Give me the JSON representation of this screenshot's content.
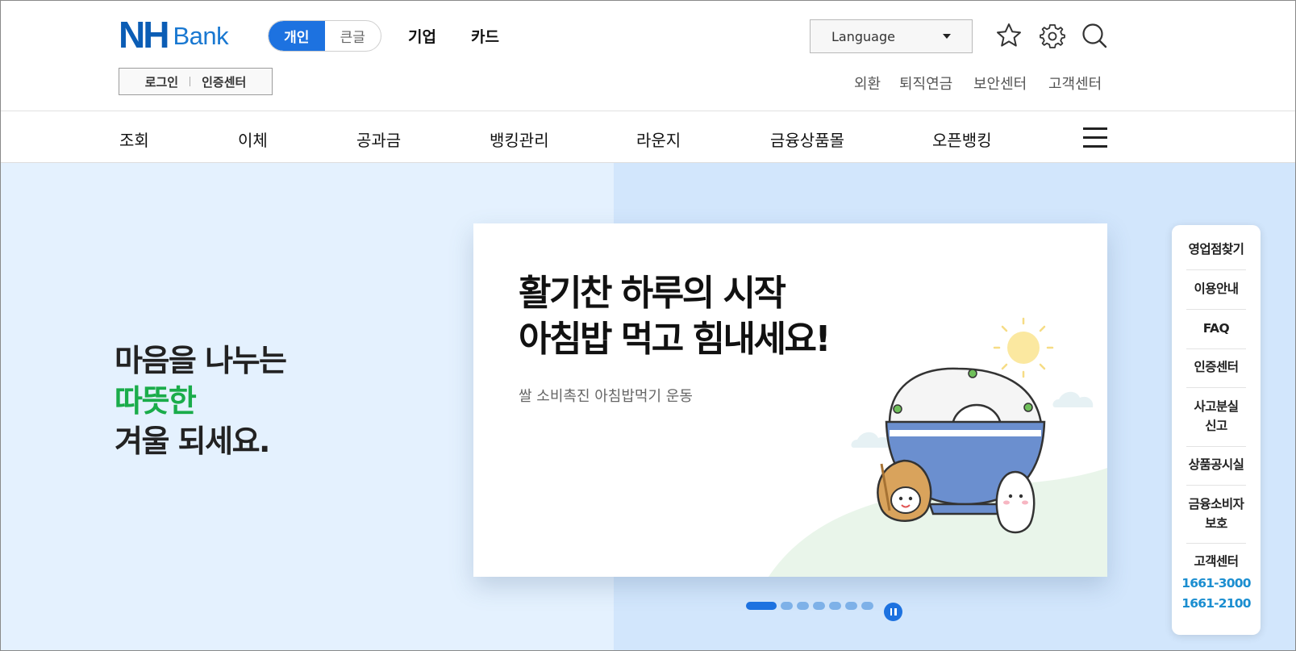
{
  "header": {
    "logo": {
      "nh": "NH",
      "bank": "Bank"
    },
    "mode_toggle": [
      {
        "label": "개인",
        "active": true
      },
      {
        "label": "큰글",
        "active": false
      }
    ],
    "top_links": [
      "기업",
      "카드"
    ],
    "login": {
      "login_label": "로그인",
      "cert_label": "인증센터"
    },
    "language": {
      "label": "Language"
    },
    "icons": [
      "star-icon",
      "gear-icon",
      "search-icon"
    ],
    "util_links": [
      "외환",
      "퇴직연금",
      "보안센터",
      "고객센터"
    ]
  },
  "nav": {
    "items": [
      "조회",
      "이체",
      "공과금",
      "뱅킹관리",
      "라운지",
      "금융상품몰",
      "오픈뱅킹"
    ],
    "menu_icon": "hamburger-icon"
  },
  "hero": {
    "line1": "마음을 나누는",
    "line2": "따뜻한",
    "line3": "겨울 되세요.",
    "accent_color": "#1aac4a"
  },
  "banner": {
    "title_line1": "활기찬 하루의 시작",
    "title_line2": "아침밥 먹고 힘내세요!",
    "subtitle": "쌀 소비촉진 아침밥먹기 운동",
    "slide_count": 7,
    "active_slide": 1
  },
  "quick_menu": {
    "items": [
      "영업점찾기",
      "이용안내",
      "FAQ",
      "인증센터",
      [
        "사고분실",
        "신고"
      ],
      "상품공시실",
      [
        "금융소비자",
        "보호"
      ],
      "고객센터"
    ],
    "phones": [
      "1661-3000",
      "1661-2100"
    ]
  },
  "colors": {
    "brand": "#0b5db5",
    "accent_blue": "#1d72e0",
    "phone": "#1b8ed0",
    "hero_left_bg": "#e4f1fe",
    "hero_right_bg": "#d2e6fc"
  }
}
